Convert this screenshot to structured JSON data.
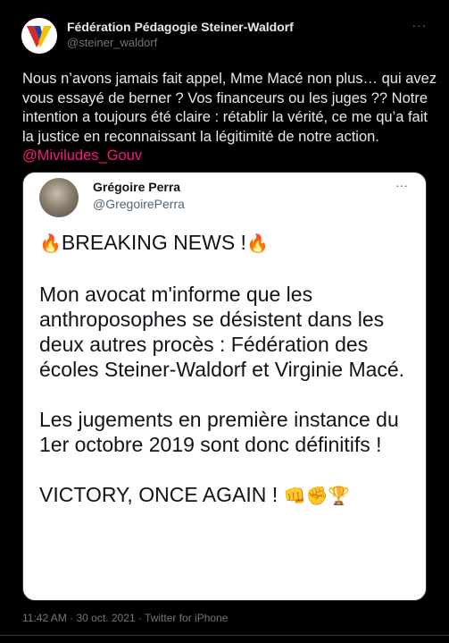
{
  "author": {
    "name": "Fédération Pédagogie Steiner-Waldorf",
    "handle": "@steiner_waldorf",
    "avatar_icon": "red-blue-yellow-v-logo"
  },
  "more_icon": "···",
  "tweet": {
    "text": "Nous n’avons jamais fait appel, Mme Macé non plus… qui avez vous essayé de berner ? Vos financeurs ou les juges ?? Notre intention a toujours été claire : rétablir la vérité, ce me qu’a fait la justice en reconnaissant la légitimité de notre action.",
    "mention": "@Miviludes_Gouv"
  },
  "quoted_tweet": {
    "author_name": "Grégoire Perra",
    "author_handle": "@GregoirePerra",
    "headline": "BREAKING NEWS !",
    "paragraph_1": "Mon avocat m'informe que les anthroposophes se désistent dans les deux autres procès : Fédération des écoles Steiner-Waldorf et Virginie Macé.",
    "paragraph_2": "Les jugements en première instance du 1er octobre 2019 sont donc définitifs !",
    "closing": "VICTORY, ONCE AGAIN !",
    "emojis": {
      "fire": "🔥",
      "fist": "👊",
      "raised_fist": "✊",
      "trophy": "🏆"
    }
  },
  "meta": {
    "time": "11:42 AM",
    "date": "30 oct. 2021",
    "source": "Twitter for iPhone",
    "separator": "·"
  },
  "colors": {
    "background": "#000000",
    "text": "#e7e9ea",
    "secondary_text": "#71767b",
    "mention": "#f91880",
    "quote_background": "#ffffff"
  }
}
